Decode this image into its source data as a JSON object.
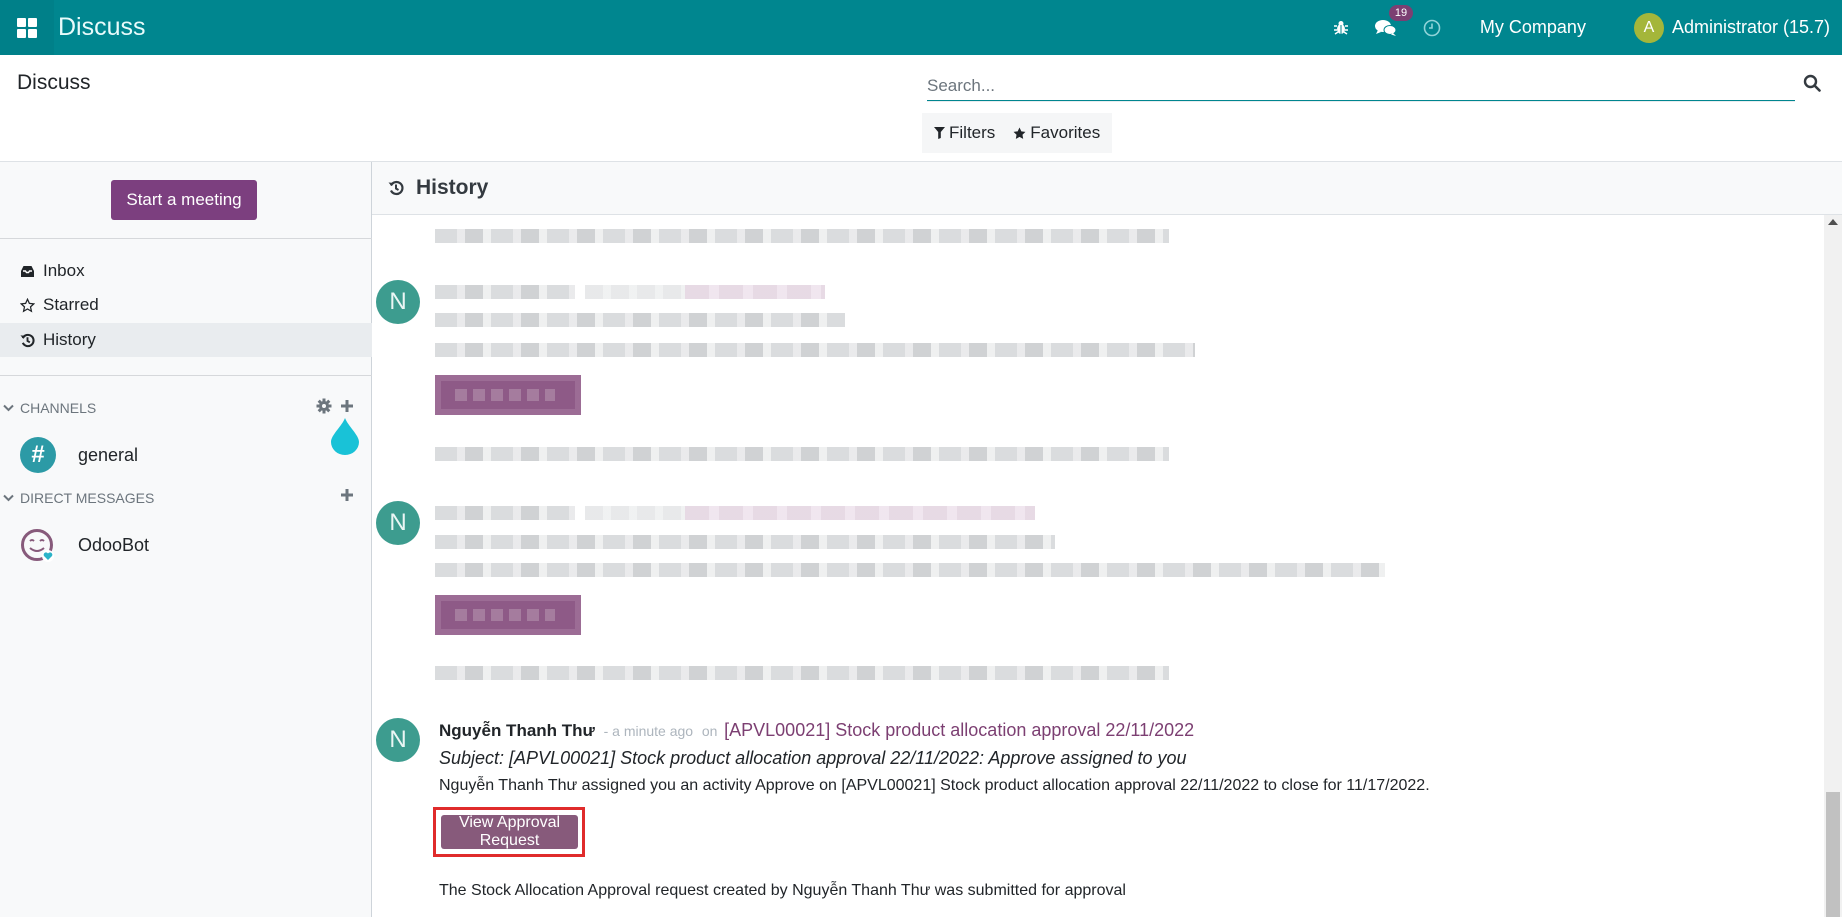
{
  "navbar": {
    "app_name": "Discuss",
    "message_badge": "19",
    "company": "My Company",
    "user_initial": "A",
    "user_name": "Administrator (15.7)",
    "accent_color": "#00868f"
  },
  "control_panel": {
    "title": "Discuss",
    "search_placeholder": "Search...",
    "search_value": "",
    "filters_label": "Filters",
    "favorites_label": "Favorites"
  },
  "sidebar": {
    "start_meeting_label": "Start a meeting",
    "mailboxes": [
      {
        "label": "Inbox",
        "icon": "inbox-icon",
        "active": false
      },
      {
        "label": "Starred",
        "icon": "star-outline-icon",
        "active": false
      },
      {
        "label": "History",
        "icon": "history-icon",
        "active": true
      }
    ],
    "channels_header": "CHANNELS",
    "channels": [
      {
        "label": "general",
        "icon": "hashtag-icon"
      }
    ],
    "dm_header": "DIRECT MESSAGES",
    "direct_messages": [
      {
        "label": "OdooBot",
        "icon": "odoobot-avatar"
      }
    ]
  },
  "thread": {
    "title": "History",
    "messages": [
      {
        "avatar_initial": "N",
        "blurred": true
      },
      {
        "avatar_initial": "N",
        "blurred": true
      },
      {
        "avatar_initial": "N",
        "author": "Nguyễn Thanh Thư",
        "time": "- a minute ago",
        "on_label": "on",
        "record_link": "[APVL00021] Stock product allocation approval 22/11/2022",
        "subject": "Subject: [APVL00021] Stock product allocation approval 22/11/2022: Approve assigned to you",
        "body": "Nguyễn Thanh Thư assigned you an activity Approve on [APVL00021] Stock product allocation approval 22/11/2022 to close for 11/17/2022.",
        "button_label": "View Approval Request",
        "footer_text": "The Stock Allocation Approval request created by Nguyễn Thanh Thư was submitted for approval"
      }
    ]
  }
}
